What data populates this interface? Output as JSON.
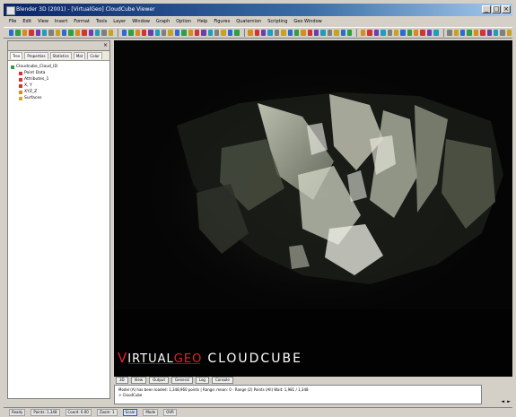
{
  "window": {
    "title": "Blender 3D (2001) - [VirtualGeo] CloudCube Viewer"
  },
  "menu": {
    "items": [
      "File",
      "Edit",
      "View",
      "Insert",
      "Format",
      "Tools",
      "Layer",
      "Window",
      "Graph",
      "Option",
      "Help",
      "Figures",
      "Quaternion",
      "Scripting",
      "Geo Window"
    ]
  },
  "toolbar": {
    "group_count_note": "",
    "colors": [
      "#2b6bd6",
      "#2d9f44",
      "#d98b1b",
      "#d3342f",
      "#6a3db3",
      "#1d9ebc",
      "#7f7f7f",
      "#c8a21a"
    ]
  },
  "left_panel": {
    "tabs": [
      "Tree",
      "Properties",
      "Statistics",
      "Mat",
      "Color"
    ],
    "tree": [
      {
        "label": "Cloudcube_Cloud_ID",
        "icon_color": "#2d9f44",
        "level": 0
      },
      {
        "label": "Point Data",
        "icon_color": "#d3342f",
        "level": 1
      },
      {
        "label": "Attributes_1",
        "icon_color": "#d3342f",
        "level": 1
      },
      {
        "label": "X, Y",
        "icon_color": "#d3342f",
        "level": 1
      },
      {
        "label": "XYZ_Z",
        "icon_color": "#d98b1b",
        "level": 1
      },
      {
        "label": "Surfaces",
        "icon_color": "#e0a325",
        "level": 1
      }
    ]
  },
  "viewport": {
    "brand": {
      "first_letter": "V",
      "irtual": "IRTUAL",
      "geo": "GEO",
      "product": "CLOUDCUBE"
    }
  },
  "bottom_tabs": [
    "3D",
    "View",
    "Output",
    "General",
    "Log",
    "Console"
  ],
  "console": {
    "line1": "Model (A) has been loaded: 1,348,960 points | Range: mean: 0 - Range (2) Points (All) Wait: 1,981 / 1,348",
    "line2": "> CloudCube"
  },
  "statusbar": {
    "fields": [
      "Ready",
      "Points: 1,348",
      "Coord: 0.00",
      "Zoom: 1",
      "Scale",
      "Mode",
      "OVR"
    ]
  },
  "colors": {
    "brand_red": "#e3222a",
    "title_start": "#0a246a",
    "title_end": "#a6caf0"
  }
}
